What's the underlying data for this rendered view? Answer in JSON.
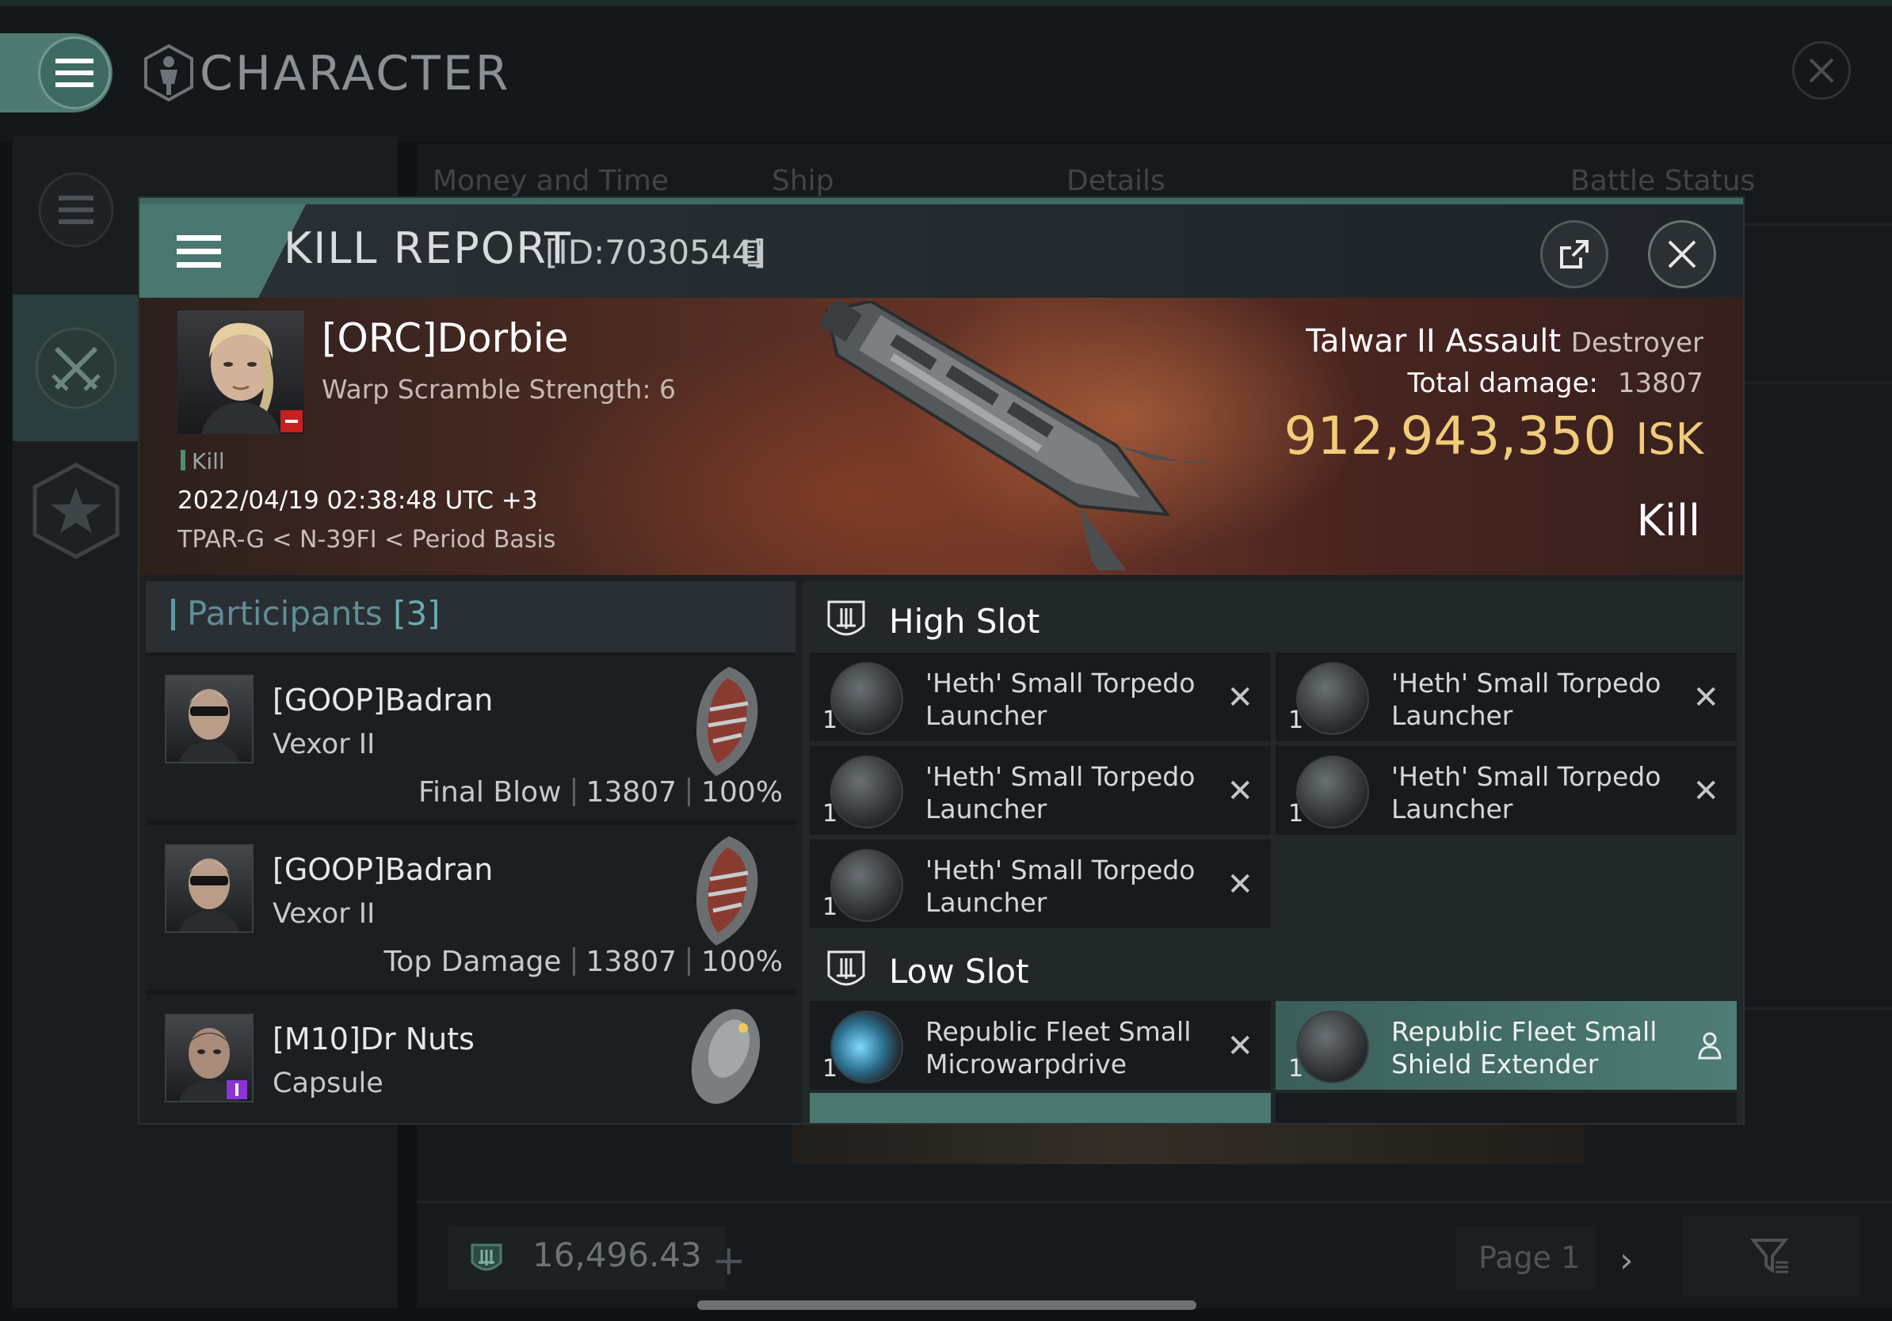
{
  "background": {
    "app_title": "CHARACTER",
    "table_headers": [
      "Money and Time",
      "Ship",
      "Details",
      "Battle Status"
    ],
    "wallet_amount": "16,496.43",
    "page_label": "Page 1"
  },
  "kill_report": {
    "title": "KILL REPORT",
    "id": "[ID:7030544]",
    "victim": {
      "name": "[ORC]Dorbie",
      "subtitle": "Warp Scramble Strength: 6",
      "tag": "Kill",
      "datetime": "2022/04/19 02:38:48 UTC +3",
      "location": "TPAR-G < N-39FI < Period Basis"
    },
    "ship": {
      "name": "Talwar II Assault",
      "class": "Destroyer",
      "total_damage_label": "Total damage:",
      "total_damage": "13807",
      "isk_value": "912,943,350",
      "isk_unit": "ISK",
      "result": "Kill"
    },
    "participants": {
      "label": "Participants",
      "count": "[3]",
      "list": [
        {
          "name": "[GOOP]Badran",
          "ship": "Vexor II",
          "role": "Final Blow",
          "damage": "13807",
          "percent": "100%"
        },
        {
          "name": "[GOOP]Badran",
          "ship": "Vexor II",
          "role": "Top Damage",
          "damage": "13807",
          "percent": "100%"
        },
        {
          "name": "[M10]Dr Nuts",
          "ship": "Capsule",
          "role": "",
          "damage": "",
          "percent": ""
        }
      ]
    },
    "fitting": {
      "high_slot_title": "High Slot",
      "high_slot": [
        {
          "name": "'Heth' Small Torpedo Launcher",
          "qty": "1"
        },
        {
          "name": "'Heth' Small Torpedo Launcher",
          "qty": "1"
        },
        {
          "name": "'Heth' Small Torpedo Launcher",
          "qty": "1"
        },
        {
          "name": "'Heth' Small Torpedo Launcher",
          "qty": "1"
        },
        {
          "name": "'Heth' Small Torpedo Launcher",
          "qty": "1"
        }
      ],
      "low_slot_title": "Low Slot",
      "low_slot": [
        {
          "name": "Republic Fleet Small Microwarpdrive",
          "qty": "1"
        },
        {
          "name": "Republic Fleet Small Shield Extender",
          "qty": "1"
        }
      ]
    }
  },
  "colors": {
    "accent_teal": "#4a7770",
    "isk_gold": "#f1cc7a",
    "banner_red": "#6a3528",
    "kill_flag_red": "#c81f1f"
  },
  "icons": [
    "menu-icon",
    "character-icon",
    "close-icon",
    "share-icon",
    "copy-icon",
    "swords-icon",
    "star-icon",
    "high-slot-icon",
    "low-slot-icon",
    "remove-icon",
    "person-icon",
    "filter-icon",
    "wallet-icon",
    "plus-icon",
    "chevron-right-icon"
  ]
}
